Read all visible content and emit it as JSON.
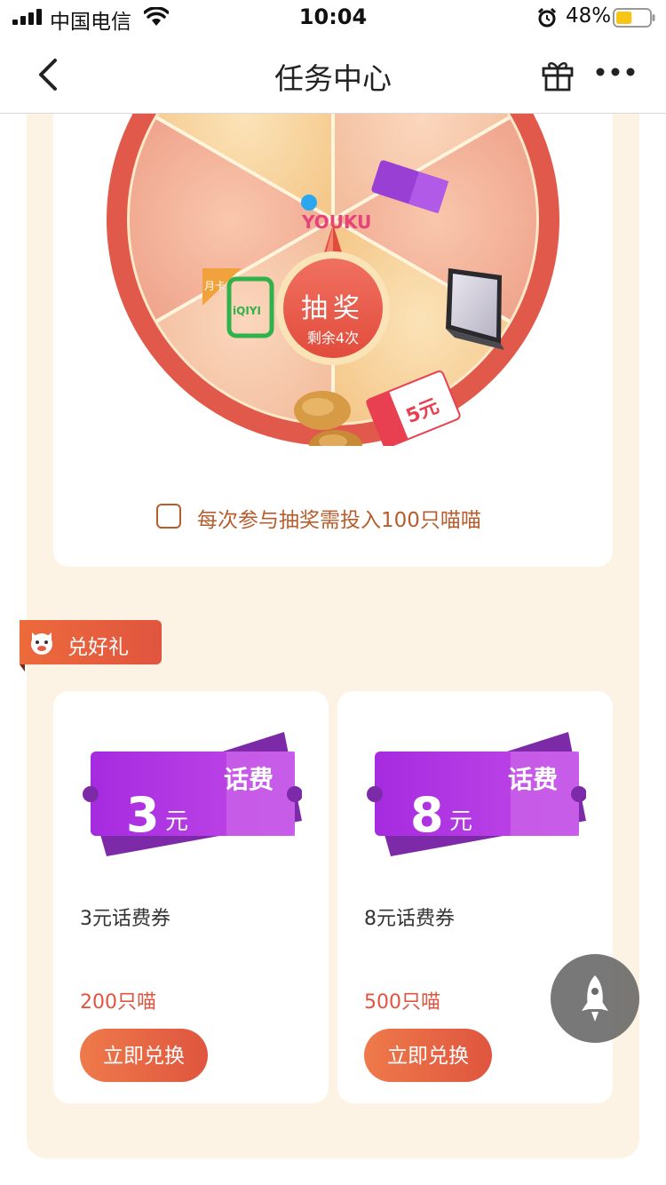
{
  "status_bar": {
    "carrier": "中国电信",
    "time": "10:04",
    "battery": "48%",
    "battery_level": 0.48
  },
  "nav": {
    "title": "任务中心"
  },
  "lottery": {
    "spin_label": "抽奖",
    "remaining": "剩余4次",
    "notice": "每次参与抽奖需投入100只喵喵",
    "notice_checked": false,
    "prize_texts": {
      "youku": "YOUKU",
      "iqiyi_badge": "月卡",
      "iqiyi": "iQIYI",
      "coupon": "5元",
      "phone_fee": "话费"
    }
  },
  "redeem": {
    "label": "兑好礼",
    "items": [
      {
        "amount": "3",
        "unit": "元",
        "kind": "话费",
        "name": "3元话费券",
        "cost": "200只喵",
        "button": "立即兑换"
      },
      {
        "amount": "8",
        "unit": "元",
        "kind": "话费",
        "name": "8元话费券",
        "cost": "500只喵",
        "button": "立即兑换"
      }
    ]
  },
  "colors": {
    "accent": "#e0553f",
    "page_bg": "#fdf3e5",
    "ticket": "#b43ce0"
  },
  "icons": [
    "signal-icon",
    "wifi-icon",
    "alarm-icon",
    "battery-icon",
    "back-icon",
    "gift-icon",
    "more-icon",
    "cat-icon",
    "rocket-icon"
  ]
}
